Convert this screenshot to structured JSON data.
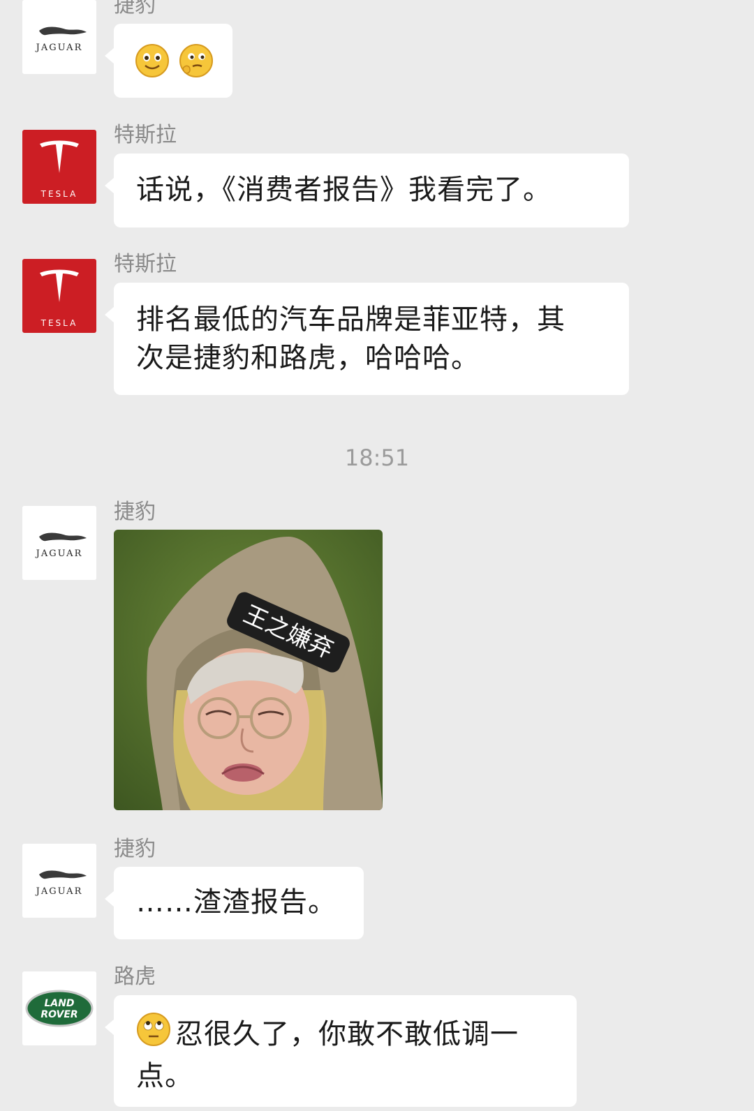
{
  "messages": [
    {
      "sender": "捷豹",
      "avatar": "jaguar",
      "type": "emoji",
      "emojis": [
        "smile-emoji-icon",
        "thinking-emoji-icon"
      ]
    },
    {
      "sender": "特斯拉",
      "avatar": "tesla",
      "type": "text",
      "text": "话说，《消费者报告》我看完了。"
    },
    {
      "sender": "特斯拉",
      "avatar": "tesla",
      "type": "text",
      "lines": [
        "排名最低的汽车品牌是菲亚特，其",
        "次是捷豹和路虎，哈哈哈。"
      ]
    },
    {
      "sender": "捷豹",
      "avatar": "jaguar",
      "type": "sticker",
      "sticker_label": "王之嫌弃"
    },
    {
      "sender": "捷豹",
      "avatar": "jaguar",
      "type": "text",
      "text": "……渣渣报告。"
    },
    {
      "sender": "路虎",
      "avatar": "land-rover",
      "type": "text",
      "lines": [
        "忍很久了，你敢不敢低调一",
        "点。"
      ]
    }
  ],
  "timestamp": "18:51",
  "logos": {
    "jaguar": "JAGUAR",
    "tesla": "TESLA",
    "land_rover_top": "LAND",
    "land_rover_bottom": "ROVER"
  },
  "colors": {
    "background": "#ebebeb",
    "bubble": "#ffffff",
    "tesla_red": "#cc1e24",
    "land_rover_green": "#1f6b3a",
    "sender_gray": "#8a8a8a"
  }
}
